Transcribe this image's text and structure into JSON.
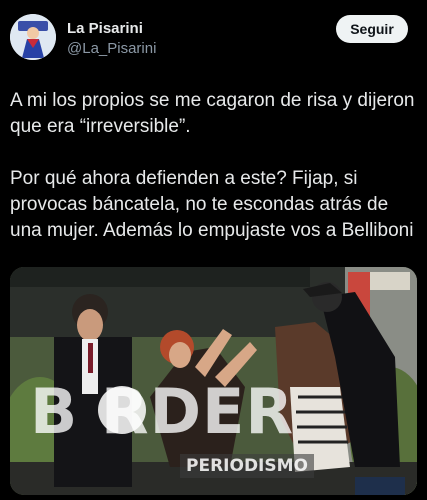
{
  "header": {
    "display_name": "La Pisarini",
    "handle": "@La_Pisarini",
    "follow_label": "Seguir"
  },
  "tweet": {
    "paragraphs": [
      "A mi los propios se me cagaron de risa y dijeron que era “irreversible”.",
      "Por qué ahora defienden a este? Fijap, si provocas báncatela, no te escondas atrás de una mujer. Además lo empujaste vos a Belliboni"
    ]
  },
  "media": {
    "watermark_text": "B  RDER",
    "watermark_sub": "PERIODISMO"
  }
}
